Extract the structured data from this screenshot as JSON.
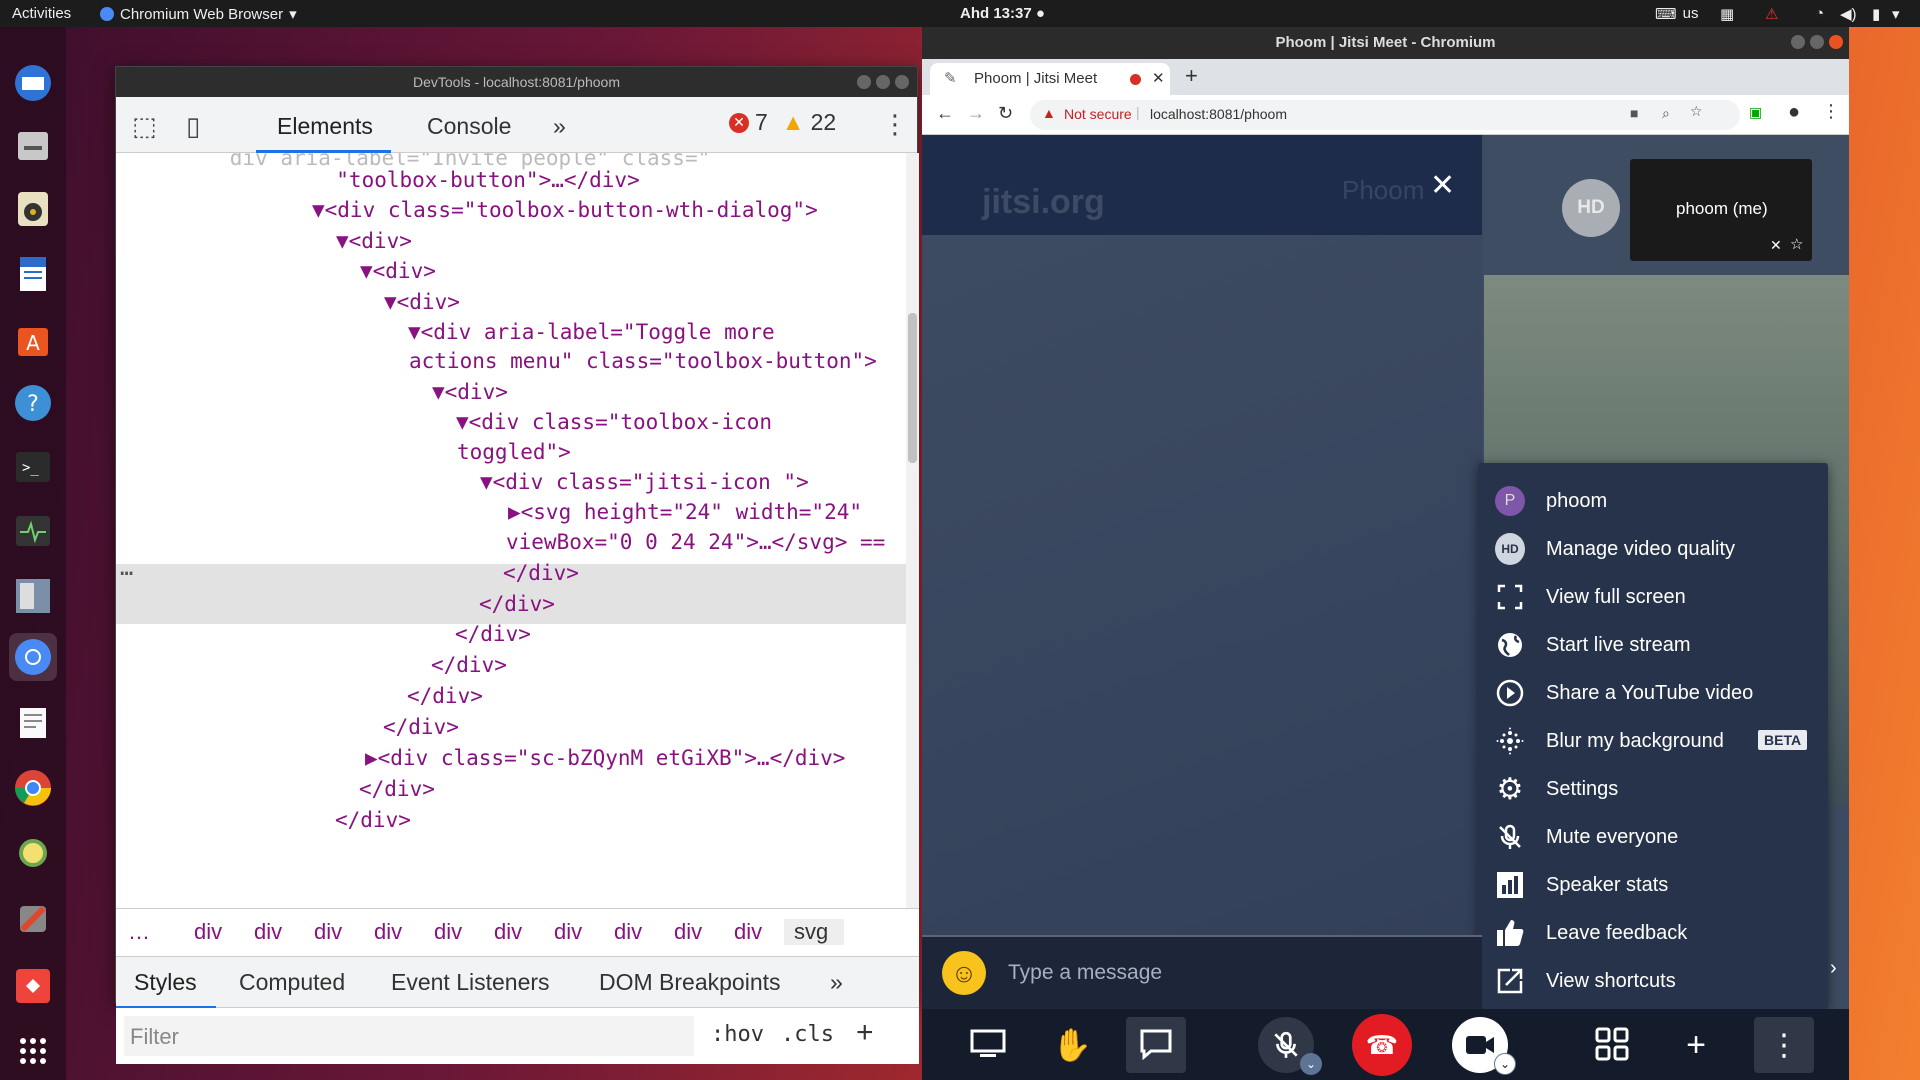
{
  "topbar": {
    "activities": "Activities",
    "app": "Chromium Web Browser",
    "clock": "Ahd 13:37 ●",
    "kb": "us"
  },
  "devtools": {
    "title": "DevTools - localhost:8081/phoom",
    "tabs": {
      "elements": "Elements",
      "console": "Console",
      "more": "»"
    },
    "errors": "7",
    "warnings": "22",
    "code_lines": [
      {
        "text": "  \"toolbox-button\">…</div>"
      },
      {
        "text": "▼<div class=\"toolbox-button-wth-dialog\">"
      },
      {
        "text": "▼<div>"
      },
      {
        "text": "▼<div>"
      },
      {
        "text": "▼<div>"
      },
      {
        "text": "▼<div aria-label=\"Toggle more"
      },
      {
        "text": "actions menu\" class=\"toolbox-button\">"
      },
      {
        "text": "▼<div>"
      },
      {
        "text": "▼<div class=\"toolbox-icon"
      },
      {
        "text": "toggled\">"
      },
      {
        "text": "▼<div class=\"jitsi-icon \">"
      },
      {
        "text": "▶<svg height=\"24\" width=\"24\""
      },
      {
        "text": "viewBox=\"0 0 24 24\">…</svg> =="
      },
      {
        "text": "</div>"
      },
      {
        "text": "</div>"
      },
      {
        "text": "</div>"
      },
      {
        "text": "</div>"
      },
      {
        "text": "</div>"
      },
      {
        "text": "</div>"
      },
      {
        "text": "▶<div class=\"sc-bZQynM etGiXB\">…</div>"
      },
      {
        "text": "</div>"
      },
      {
        "text": "</div>"
      }
    ],
    "ellipsis": "…",
    "breadcrumbs": [
      "…",
      "div",
      "div",
      "div",
      "div",
      "div",
      "div",
      "div",
      "div",
      "div",
      "div",
      "svg"
    ],
    "style_tabs": {
      "styles": "Styles",
      "computed": "Computed",
      "listeners": "Event Listeners",
      "dom": "DOM Breakpoints",
      "more": "»"
    },
    "filter_placeholder": "Filter",
    "hov": ":hov",
    "cls": ".cls",
    "plus": "+"
  },
  "browser": {
    "title": "Phoom | Jitsi Meet - Chromium",
    "tab_title": "Phoom | Jitsi Meet",
    "not_secure": "Not secure",
    "url": "localhost:8081/phoom"
  },
  "meeting": {
    "watermark": "jitsi.org",
    "room_name": "Phoom",
    "hd_badge": "HD",
    "self_label": "phoom (me)",
    "menu": [
      {
        "icon": "avatar-p",
        "label": "phoom"
      },
      {
        "icon": "hd-badge",
        "label": "Manage video quality"
      },
      {
        "icon": "fullscreen-icon",
        "label": "View full screen"
      },
      {
        "icon": "globe-icon",
        "label": "Start live stream"
      },
      {
        "icon": "play-icon",
        "label": "Share a YouTube video"
      },
      {
        "icon": "blur-icon",
        "label": "Blur my background",
        "badge": "BETA"
      },
      {
        "icon": "gear-icon",
        "label": "Settings"
      },
      {
        "icon": "mic-off-icon",
        "label": "Mute everyone"
      },
      {
        "icon": "bar-chart-icon",
        "label": "Speaker stats"
      },
      {
        "icon": "thumbs-up-icon",
        "label": "Leave feedback"
      },
      {
        "icon": "shortcut-icon",
        "label": "View shortcuts"
      }
    ],
    "avatar_letter": "P",
    "chat_placeholder": "Type a message"
  },
  "colors": {
    "hangup": "#e31b23",
    "menu_bg": "#27334a",
    "error": "#d93025",
    "warn": "#f2a600"
  }
}
